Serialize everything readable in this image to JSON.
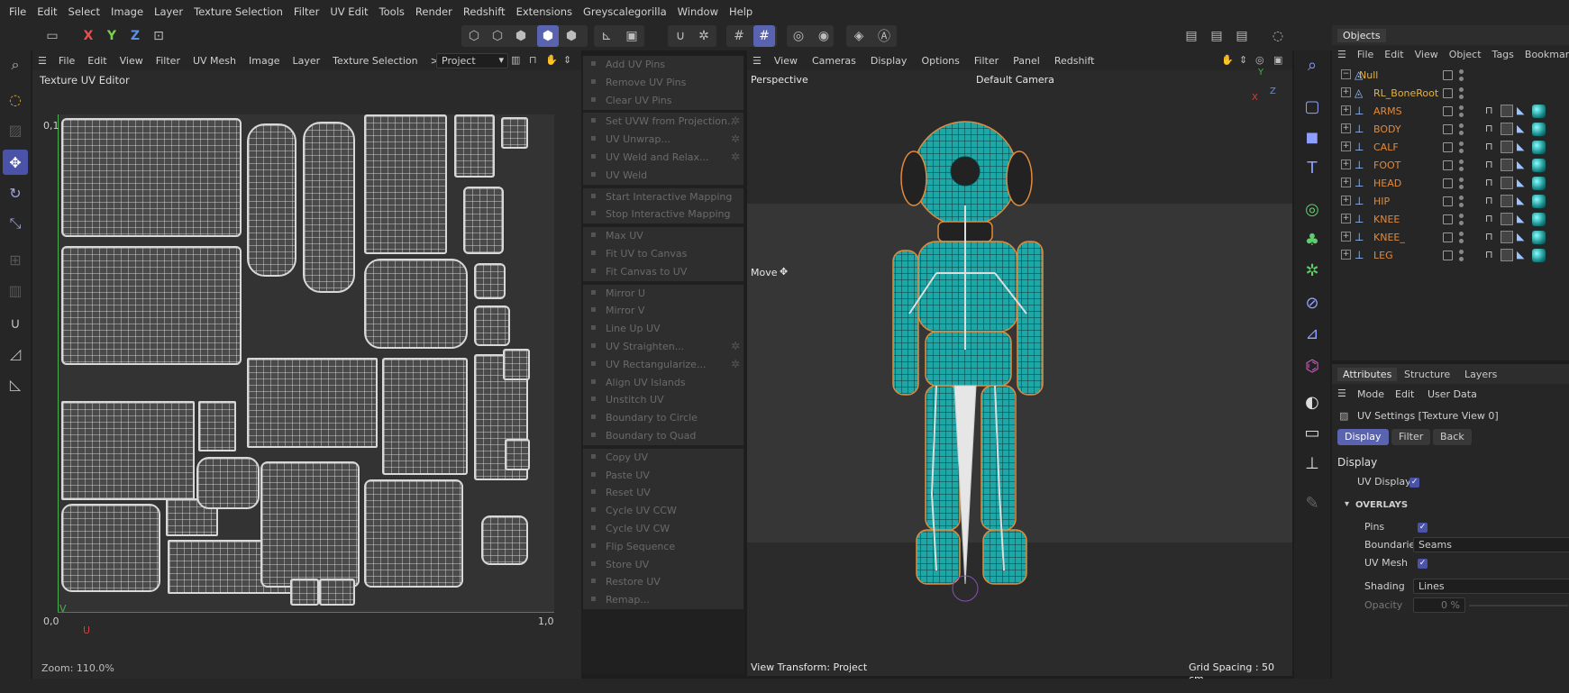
{
  "menubar": [
    "File",
    "Edit",
    "Select",
    "Image",
    "Layer",
    "Texture Selection",
    "Filter",
    "UV Edit",
    "Tools",
    "Render",
    "Redshift",
    "Extensions",
    "Greyscalegorilla",
    "Window",
    "Help"
  ],
  "toolbar": {
    "axes": [
      "X",
      "Y",
      "Z"
    ]
  },
  "uv_editor": {
    "menu": [
      "File",
      "Edit",
      "View",
      "Filter",
      "UV Mesh",
      "Image",
      "Layer",
      "Texture Selection"
    ],
    "more": ">",
    "project_select": "Project",
    "title": "Texture UV Editor",
    "label_top": "0,1",
    "label_origin": "0,0",
    "label_right": "1,0",
    "axis_u": "U",
    "axis_v": "V",
    "zoom": "Zoom: 110.0%"
  },
  "uv_commands": [
    {
      "label": "Add UV Pins",
      "icon": "pin-icon",
      "gear": false
    },
    {
      "label": "Remove UV Pins",
      "icon": "pin-remove-icon",
      "gear": false
    },
    {
      "label": "Clear UV Pins",
      "icon": "clear-icon",
      "gear": false
    },
    {
      "label": "Set UVW from Projection...",
      "icon": "projection-icon",
      "gear": true
    },
    {
      "label": "UV Unwrap...",
      "icon": "unwrap-icon",
      "gear": true
    },
    {
      "label": "UV Weld and Relax...",
      "icon": "weld-relax-icon",
      "gear": true
    },
    {
      "label": "UV Weld",
      "icon": "weld-icon",
      "gear": false
    },
    {
      "label": "Start Interactive Mapping",
      "icon": "play-icon",
      "gear": false
    },
    {
      "label": "Stop Interactive Mapping",
      "icon": "stop-icon",
      "gear": false
    },
    {
      "label": "Max UV",
      "icon": "max-uv-icon",
      "gear": false
    },
    {
      "label": "Fit UV to Canvas",
      "icon": "fit-uv-icon",
      "gear": false
    },
    {
      "label": "Fit Canvas to UV",
      "icon": "fit-canvas-icon",
      "gear": false
    },
    {
      "label": "Mirror U",
      "icon": "mirror-u-icon",
      "gear": false
    },
    {
      "label": "Mirror V",
      "icon": "mirror-v-icon",
      "gear": false
    },
    {
      "label": "Line Up UV",
      "icon": "line-up-icon",
      "gear": false
    },
    {
      "label": "UV Straighten...",
      "icon": "straighten-icon",
      "gear": true
    },
    {
      "label": "UV Rectangularize...",
      "icon": "rectangularize-icon",
      "gear": true
    },
    {
      "label": "Align UV Islands",
      "icon": "align-icon",
      "gear": false
    },
    {
      "label": "Unstitch UV",
      "icon": "unstitch-icon",
      "gear": false
    },
    {
      "label": "Boundary to Circle",
      "icon": "circle-icon",
      "gear": false
    },
    {
      "label": "Boundary to Quad",
      "icon": "quad-icon",
      "gear": false
    },
    {
      "label": "Copy UV",
      "icon": "copy-icon",
      "gear": false
    },
    {
      "label": "Paste UV",
      "icon": "paste-icon",
      "gear": false
    },
    {
      "label": "Reset UV",
      "icon": "reset-icon",
      "gear": false
    },
    {
      "label": "Cycle UV CCW",
      "icon": "cycle-ccw-icon",
      "gear": false
    },
    {
      "label": "Cycle UV CW",
      "icon": "cycle-cw-icon",
      "gear": false
    },
    {
      "label": "Flip Sequence",
      "icon": "flip-icon",
      "gear": false
    },
    {
      "label": "Store UV",
      "icon": "store-icon",
      "gear": false
    },
    {
      "label": "Restore UV",
      "icon": "restore-icon",
      "gear": false
    },
    {
      "label": "Remap...",
      "icon": "remap-icon",
      "gear": false
    }
  ],
  "viewport": {
    "menu": [
      "View",
      "Cameras",
      "Display",
      "Options",
      "Filter",
      "Panel",
      "Redshift"
    ],
    "name": "Perspective",
    "camera": "Default Camera",
    "move_label": "Move",
    "view_transform": "View Transform: Project",
    "grid_spacing": "Grid Spacing : 50 cm",
    "axis_labels": [
      "Y",
      "Z",
      "X"
    ]
  },
  "objects": {
    "tab": "Objects",
    "menu": [
      "File",
      "Edit",
      "View",
      "Object",
      "Tags",
      "Bookmarks"
    ],
    "rows": [
      {
        "name": "Null",
        "color": "#e8b23c"
      },
      {
        "name": "RL_BoneRoot",
        "color": "#e8b23c"
      },
      {
        "name": "ARMS",
        "color": "#e08a3c"
      },
      {
        "name": "BODY",
        "color": "#e08a3c"
      },
      {
        "name": "CALF",
        "color": "#e08a3c"
      },
      {
        "name": "FOOT",
        "color": "#e08a3c"
      },
      {
        "name": "HEAD",
        "color": "#e08a3c"
      },
      {
        "name": "HIP",
        "color": "#e08a3c"
      },
      {
        "name": "KNEE",
        "color": "#e08a3c"
      },
      {
        "name": "KNEE_",
        "color": "#e08a3c"
      },
      {
        "name": "LEG",
        "color": "#e08a3c"
      }
    ]
  },
  "attributes": {
    "tabs": [
      "Attributes",
      "Structure",
      "Layers"
    ],
    "menu": [
      "Mode",
      "Edit",
      "User Data"
    ],
    "header": "UV Settings [Texture View 0]",
    "buttons": [
      "Display",
      "Filter",
      "Back"
    ],
    "section": "Display",
    "uv_display_label": "UV Display",
    "overlays_label": "OVERLAYS",
    "pins_label": "Pins",
    "boundaries_label": "Boundaries",
    "boundaries_value": "Seams",
    "uvmesh_label": "UV Mesh",
    "shading_label": "Shading",
    "shading_value": "Lines",
    "opacity_label": "Opacity",
    "opacity_value": "0 %"
  },
  "colors": {
    "accent": "#5a63b0",
    "mesh": "#1fa6a6",
    "outline": "#e08a3c"
  }
}
